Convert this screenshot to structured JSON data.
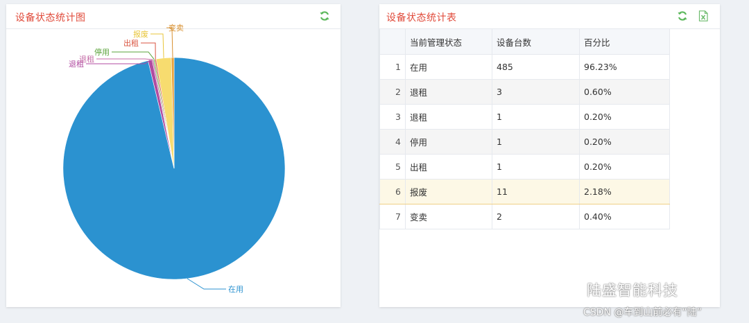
{
  "left_panel": {
    "title": "设备状态统计图",
    "refresh_icon": "refresh-icon"
  },
  "right_panel": {
    "title": "设备状态统计表",
    "refresh_icon": "refresh-icon",
    "export_icon": "excel-export-icon",
    "columns": [
      "",
      "当前管理状态",
      "设备台数",
      "百分比"
    ],
    "rows": [
      {
        "idx": "1",
        "status": "在用",
        "count": "485",
        "pct": "96.23%"
      },
      {
        "idx": "2",
        "status": "退租",
        "count": "3",
        "pct": "0.60%"
      },
      {
        "idx": "3",
        "status": "退租",
        "count": "1",
        "pct": "0.20%"
      },
      {
        "idx": "4",
        "status": "停用",
        "count": "1",
        "pct": "0.20%"
      },
      {
        "idx": "5",
        "status": "出租",
        "count": "1",
        "pct": "0.20%"
      },
      {
        "idx": "6",
        "status": "报废",
        "count": "11",
        "pct": "2.18%"
      },
      {
        "idx": "7",
        "status": "变卖",
        "count": "2",
        "pct": "0.40%"
      }
    ],
    "selected_row": 6
  },
  "chart_data": {
    "type": "pie",
    "categories": [
      "在用",
      "退租",
      "退租",
      "停用",
      "出租",
      "报废",
      "变卖"
    ],
    "values": [
      485,
      3,
      1,
      1,
      1,
      11,
      2
    ],
    "colors": [
      "#2b92d0",
      "#b04aa0",
      "#c46aa6",
      "#7cc45e",
      "#e0604a",
      "#f7dc6f",
      "#e8a23c"
    ],
    "label_colors": [
      "#2b92d0",
      "#b04aa0",
      "#c46aa6",
      "#5aa33a",
      "#d9533f",
      "#e8c53a",
      "#d89030"
    ]
  },
  "watermark": {
    "brand": "陆盛智能科技",
    "source": "CSDN @车到山前必有“陆”"
  }
}
